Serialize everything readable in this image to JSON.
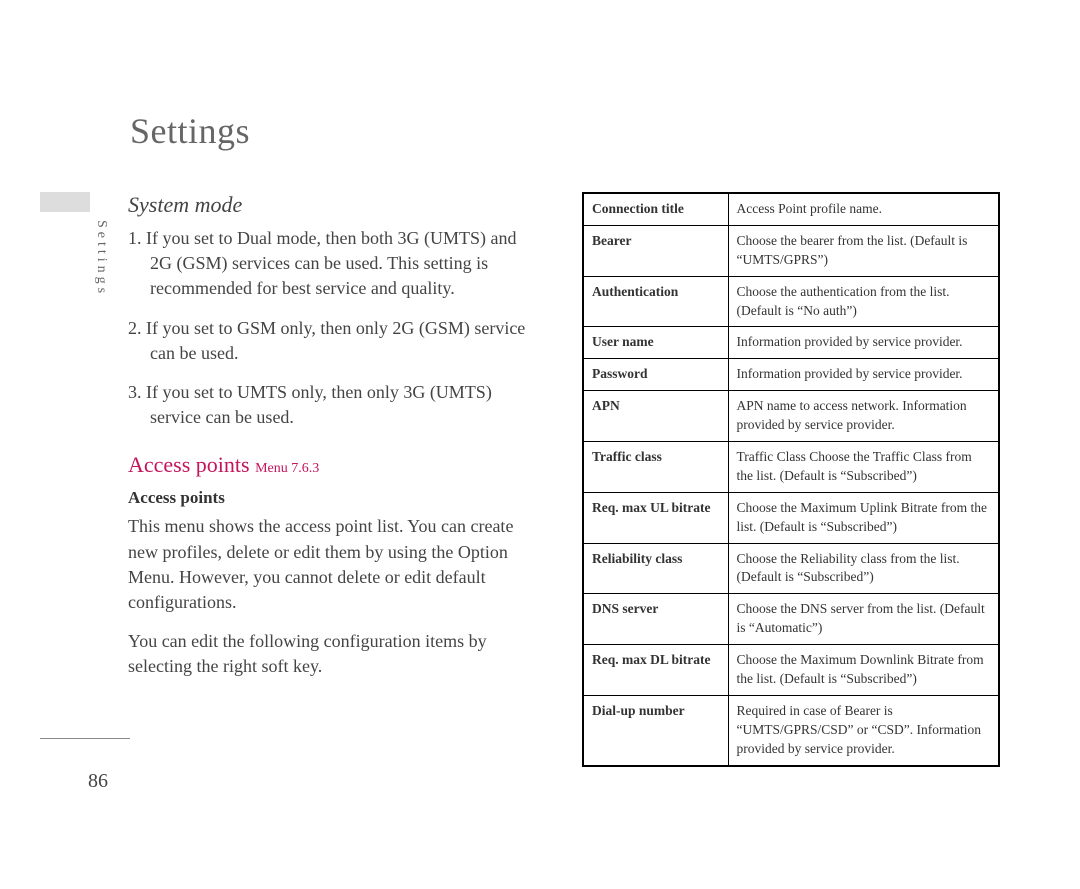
{
  "pageTitle": "Settings",
  "sideLabel": "Settings",
  "pageNumber": "86",
  "left": {
    "systemMode": {
      "heading": "System mode",
      "items": [
        "1. If you set to Dual mode, then both 3G (UMTS) and 2G (GSM) services can be used. This setting is recommended for best service and quality.",
        "2. If you set to GSM only, then only 2G (GSM) service can be used.",
        "3. If you set to UMTS only, then only 3G (UMTS) service can be used."
      ]
    },
    "accessPoints": {
      "heading": "Access points",
      "menuRef": "Menu 7.6.3",
      "boldSub": "Access points",
      "p1": "This menu shows the access point list. You can create new profiles, delete or edit them by using the Option Menu. However, you cannot delete or edit default configurations.",
      "p2": "You can edit the following configuration items by selecting the right soft key."
    }
  },
  "table": {
    "rows": [
      {
        "k": "Connection title",
        "v": "Access Point profile name."
      },
      {
        "k": "Bearer",
        "v": "Choose the bearer from the list. (Default is “UMTS/GPRS”)"
      },
      {
        "k": "Authentication",
        "v": "Choose the authentication from the list. (Default is “No auth”)"
      },
      {
        "k": "User name",
        "v": "Information provided by service provider."
      },
      {
        "k": "Password",
        "v": "Information provided by service provider."
      },
      {
        "k": "APN",
        "v": "APN name to access network. Information provided by service provider."
      },
      {
        "k": "Traffic class",
        "v": "Traffic Class Choose the Traffic Class from the list. (Default is “Subscribed”)"
      },
      {
        "k": "Req. max UL bitrate",
        "v": "Choose the Maximum Uplink Bitrate from the list. (Default is “Subscribed”)"
      },
      {
        "k": "Reliability class",
        "v": "Choose the Reliability class from the list. (Default is “Subscribed”)"
      },
      {
        "k": "DNS server",
        "v": "Choose the DNS server from the list. (Default is “Automatic”)"
      },
      {
        "k": "Req. max DL bitrate",
        "v": "Choose the Maximum Downlink Bitrate from the list. (Default is “Subscribed”)"
      },
      {
        "k": "Dial-up number",
        "v": "Required in case of Bearer is “UMTS/GPRS/CSD” or “CSD”. Information provided by service provider."
      }
    ]
  }
}
